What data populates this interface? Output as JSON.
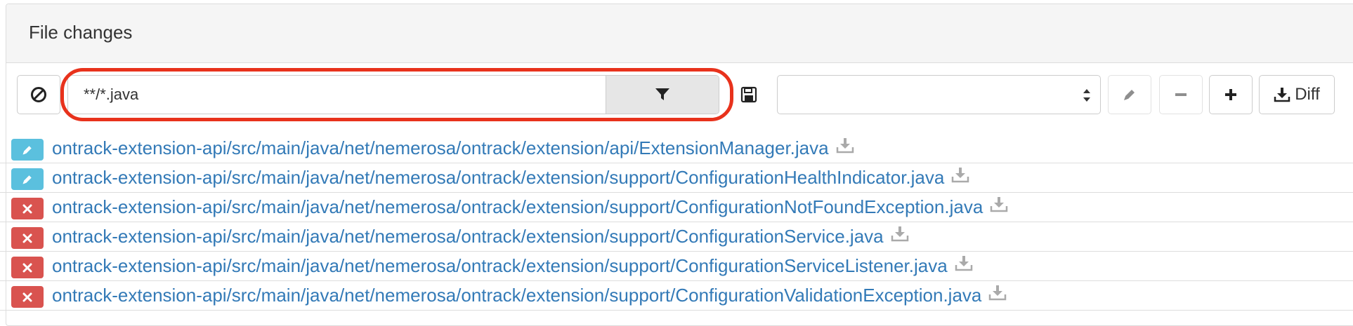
{
  "panel": {
    "title": "File changes"
  },
  "filter": {
    "value": "**/*.java",
    "placeholder": ""
  },
  "select": {
    "value": ""
  },
  "toolbar": {
    "diff_label": "Diff"
  },
  "colors": {
    "highlight": "#e8321c",
    "modified_badge": "#5bc0de",
    "deleted_badge": "#d9534f",
    "link": "#337ab7"
  },
  "files": [
    {
      "status": "modified",
      "icon": "pencil-icon",
      "path": "ontrack-extension-api/src/main/java/net/nemerosa/ontrack/extension/api/ExtensionManager.java"
    },
    {
      "status": "modified",
      "icon": "pencil-icon",
      "path": "ontrack-extension-api/src/main/java/net/nemerosa/ontrack/extension/support/ConfigurationHealthIndicator.java"
    },
    {
      "status": "deleted",
      "icon": "x-icon",
      "path": "ontrack-extension-api/src/main/java/net/nemerosa/ontrack/extension/support/ConfigurationNotFoundException.java"
    },
    {
      "status": "deleted",
      "icon": "x-icon",
      "path": "ontrack-extension-api/src/main/java/net/nemerosa/ontrack/extension/support/ConfigurationService.java"
    },
    {
      "status": "deleted",
      "icon": "x-icon",
      "path": "ontrack-extension-api/src/main/java/net/nemerosa/ontrack/extension/support/ConfigurationServiceListener.java"
    },
    {
      "status": "deleted",
      "icon": "x-icon",
      "path": "ontrack-extension-api/src/main/java/net/nemerosa/ontrack/extension/support/ConfigurationValidationException.java"
    }
  ]
}
